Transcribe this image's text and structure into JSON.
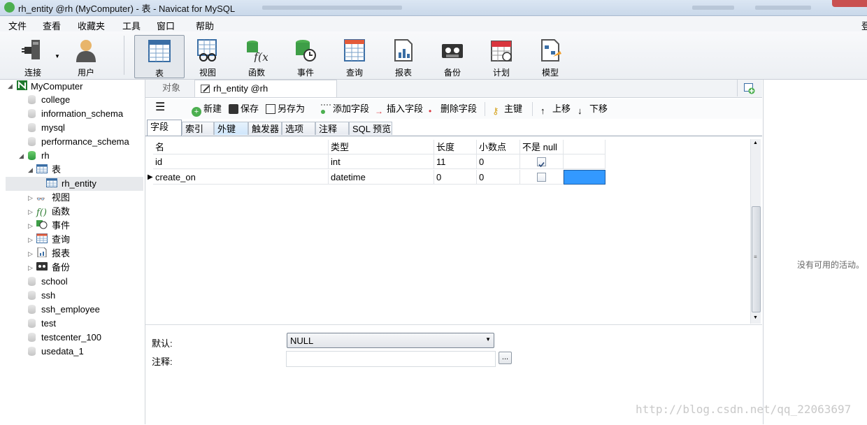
{
  "window": {
    "title": "rh_entity @rh (MyComputer) - 表 - Navicat for MySQL",
    "right_edge_char": "登"
  },
  "menu": [
    "文件",
    "查看",
    "收藏夹",
    "工具",
    "窗口",
    "帮助"
  ],
  "toolbar": [
    {
      "label": "连接",
      "icon": "connection-icon"
    },
    {
      "label": "用户",
      "icon": "user-icon"
    },
    {
      "label": "表",
      "icon": "table-icon",
      "active": true
    },
    {
      "label": "视图",
      "icon": "view-icon"
    },
    {
      "label": "函数",
      "icon": "function-icon"
    },
    {
      "label": "事件",
      "icon": "event-icon"
    },
    {
      "label": "查询",
      "icon": "query-icon"
    },
    {
      "label": "报表",
      "icon": "report-icon"
    },
    {
      "label": "备份",
      "icon": "backup-icon"
    },
    {
      "label": "计划",
      "icon": "schedule-icon"
    },
    {
      "label": "模型",
      "icon": "model-icon"
    }
  ],
  "sidebar": {
    "connection": "MyComputer",
    "databases_top": [
      "college",
      "information_schema",
      "mysql",
      "performance_schema"
    ],
    "open_db": "rh",
    "tables_node": "表",
    "selected_table": "rh_entity",
    "rh_children": [
      "视图",
      "函数",
      "事件",
      "查询",
      "报表",
      "备份"
    ],
    "databases_bottom": [
      "school",
      "ssh",
      "ssh_employee",
      "test",
      "testcenter_100",
      "usedata_1"
    ]
  },
  "tabs": {
    "objects": "对象",
    "active": "rh_entity @rh (MyComputer..."
  },
  "subtoolbar": {
    "new": "新建",
    "save": "保存",
    "save_as": "另存为",
    "add_field": "添加字段",
    "insert_field": "插入字段",
    "delete_field": "删除字段",
    "primary_key": "主键",
    "move_up": "上移",
    "move_down": "下移"
  },
  "field_tabs": [
    "字段",
    "索引",
    "外键",
    "触发器",
    "选项",
    "注释",
    "SQL 预览"
  ],
  "grid": {
    "headers": [
      "名",
      "类型",
      "长度",
      "小数点",
      "不是 null"
    ],
    "rows": [
      {
        "name": "id",
        "type": "int",
        "length": "11",
        "decimals": "0",
        "not_null": true
      },
      {
        "name": "create_on",
        "type": "datetime",
        "length": "0",
        "decimals": "0",
        "not_null": false
      }
    ]
  },
  "props": {
    "default_label": "默认:",
    "default_value": "NULL",
    "comment_label": "注释:",
    "ellipsis": "..."
  },
  "right_panel": {
    "message": "没有可用的活动。"
  },
  "watermark": "http://blog.csdn.net/qq_22063697"
}
